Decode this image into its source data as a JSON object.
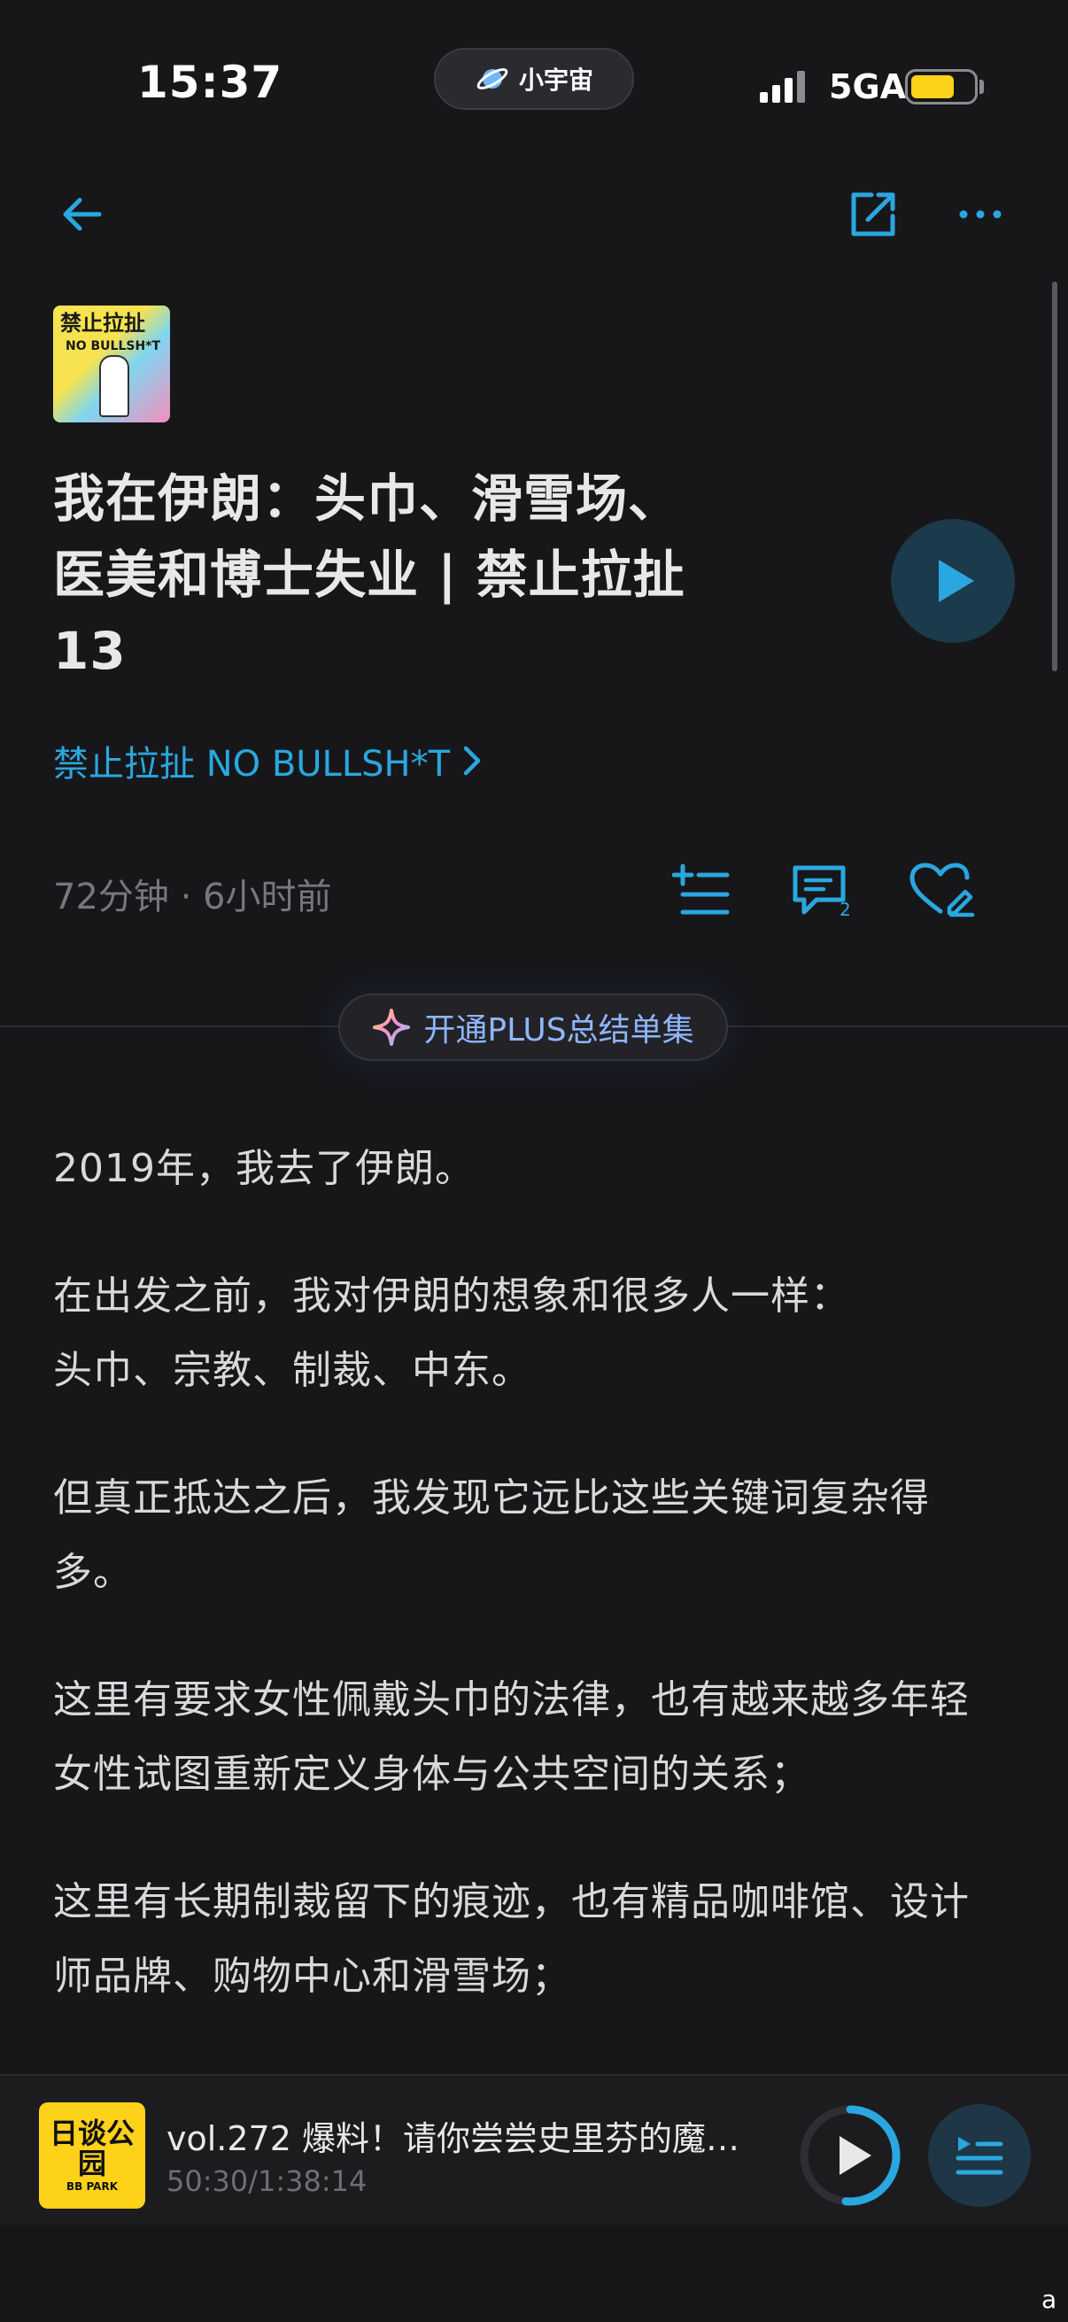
{
  "status_bar": {
    "time": "15:37",
    "island_label": "小宇宙",
    "network": "5GA",
    "battery_level": 0.7,
    "battery_color": "#ffd21a"
  },
  "nav": {
    "back_icon": "arrow-left-icon",
    "share_icon": "share-external-icon",
    "more_icon": "more-dots-icon"
  },
  "podcast": {
    "cover_title": "禁止拉扯",
    "cover_subtitle": "NO BULLSH*T",
    "name": "禁止拉扯 NO BULLSH*T"
  },
  "episode": {
    "title_lines": [
      "我在伊朗：头巾、滑雪场、",
      "医美和博士失业 | 禁止拉扯",
      "13"
    ],
    "meta": "72分钟 · 6小时前",
    "comment_count": "2"
  },
  "plus_button": {
    "label": "开通PLUS总结单集"
  },
  "article": {
    "paragraphs": [
      "2019年，我去了伊朗。",
      "在出发之前，我对伊朗的想象和很多人一样：\n头巾、宗教、制裁、中东。",
      "但真正抵达之后，我发现它远比这些关键词复杂得多。",
      "这里有要求女性佩戴头巾的法律，也有越来越多年轻女性试图重新定义身体与公共空间的关系；",
      "这里有长期制裁留下的痕迹，也有精品咖啡馆、设计师品牌、购物中心和滑雪场；"
    ]
  },
  "player": {
    "cover_title": "日谈公园",
    "cover_subtitle": "BB PARK",
    "title": "vol.272 爆料！请你尝尝史里芬的魔幻...",
    "time": "50:30/1:38:14",
    "progress": 0.515
  },
  "corner_mark": "a",
  "colors": {
    "accent": "#2aa7e0",
    "background": "#17171a"
  }
}
